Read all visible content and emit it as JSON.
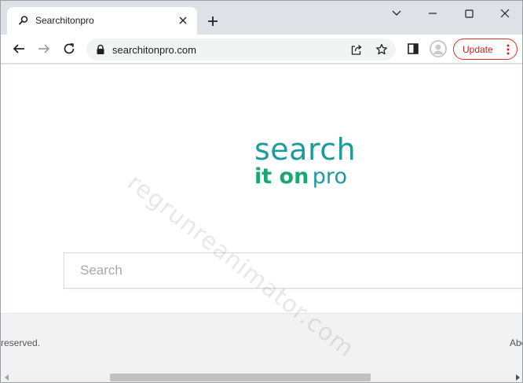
{
  "tab": {
    "title": "Searchitonpro",
    "favicon": "search-icon"
  },
  "toolbar": {
    "url": "searchitonpro.com",
    "update_label": "Update"
  },
  "logo": {
    "line1": "search",
    "line2_bold": "it on",
    "line2_thin": "pro"
  },
  "search": {
    "placeholder": "Search",
    "value": ""
  },
  "footer": {
    "left_text": "reserved.",
    "right_text": "Abo"
  },
  "watermark": "regrunreanimator.com",
  "colors": {
    "logo_teal": "#1a9c9c",
    "logo_green": "#1ba86f",
    "update_red": "#d93025"
  }
}
